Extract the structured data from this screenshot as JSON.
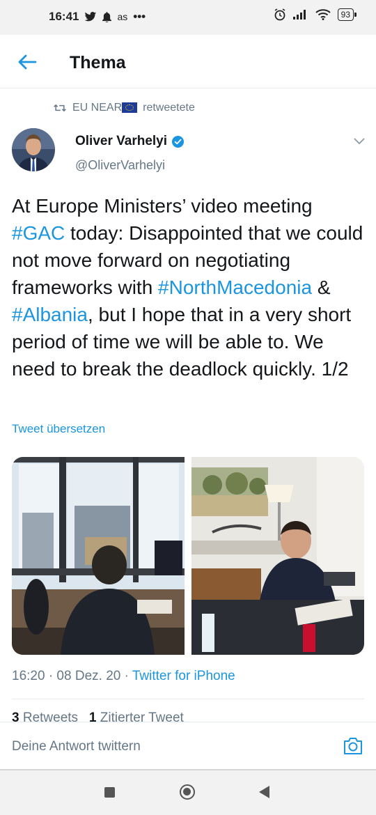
{
  "status_bar": {
    "time": "16:41",
    "carrier_text": "as",
    "more": "•••",
    "battery": "93",
    "icons": [
      "twitter-bird-icon",
      "bell-icon",
      "alarm-icon",
      "signal-icon",
      "wifi-icon",
      "battery-icon"
    ]
  },
  "header": {
    "title": "Thema",
    "back_icon": "arrow-left-icon"
  },
  "retweet": {
    "account": "EU NEAR",
    "suffix": "retweetete"
  },
  "tweet": {
    "author_name": "Oliver Varhelyi",
    "author_handle": "@OliverVarhelyi",
    "verified": true,
    "text_parts": {
      "p1": "At Europe Ministers’ video meeting ",
      "tag1": "#GAC",
      "p2": " today: Disappointed that we could not move forward on negotiating frameworks with ",
      "tag2": "#NorthMacedonia",
      "p3": " & ",
      "tag3": "#Albania",
      "p4": ", but I hope that in a very short period of time we will be able to. We need to break the deadlock quickly. 1/2"
    },
    "translate_label": "Tweet übersetzen",
    "timestamp": "16:20 · 08 Dez. 20 · ",
    "source": "Twitter for iPhone",
    "stats": {
      "retweets_count": "3",
      "retweets_label": "Retweets",
      "quotes_count": "1",
      "quotes_label": "Zitierter Tweet"
    }
  },
  "reply": {
    "placeholder": "Deine Antwort twittern"
  },
  "colors": {
    "accent": "#1b95e0",
    "secondary_text": "#657786",
    "primary_text": "#14171a"
  }
}
